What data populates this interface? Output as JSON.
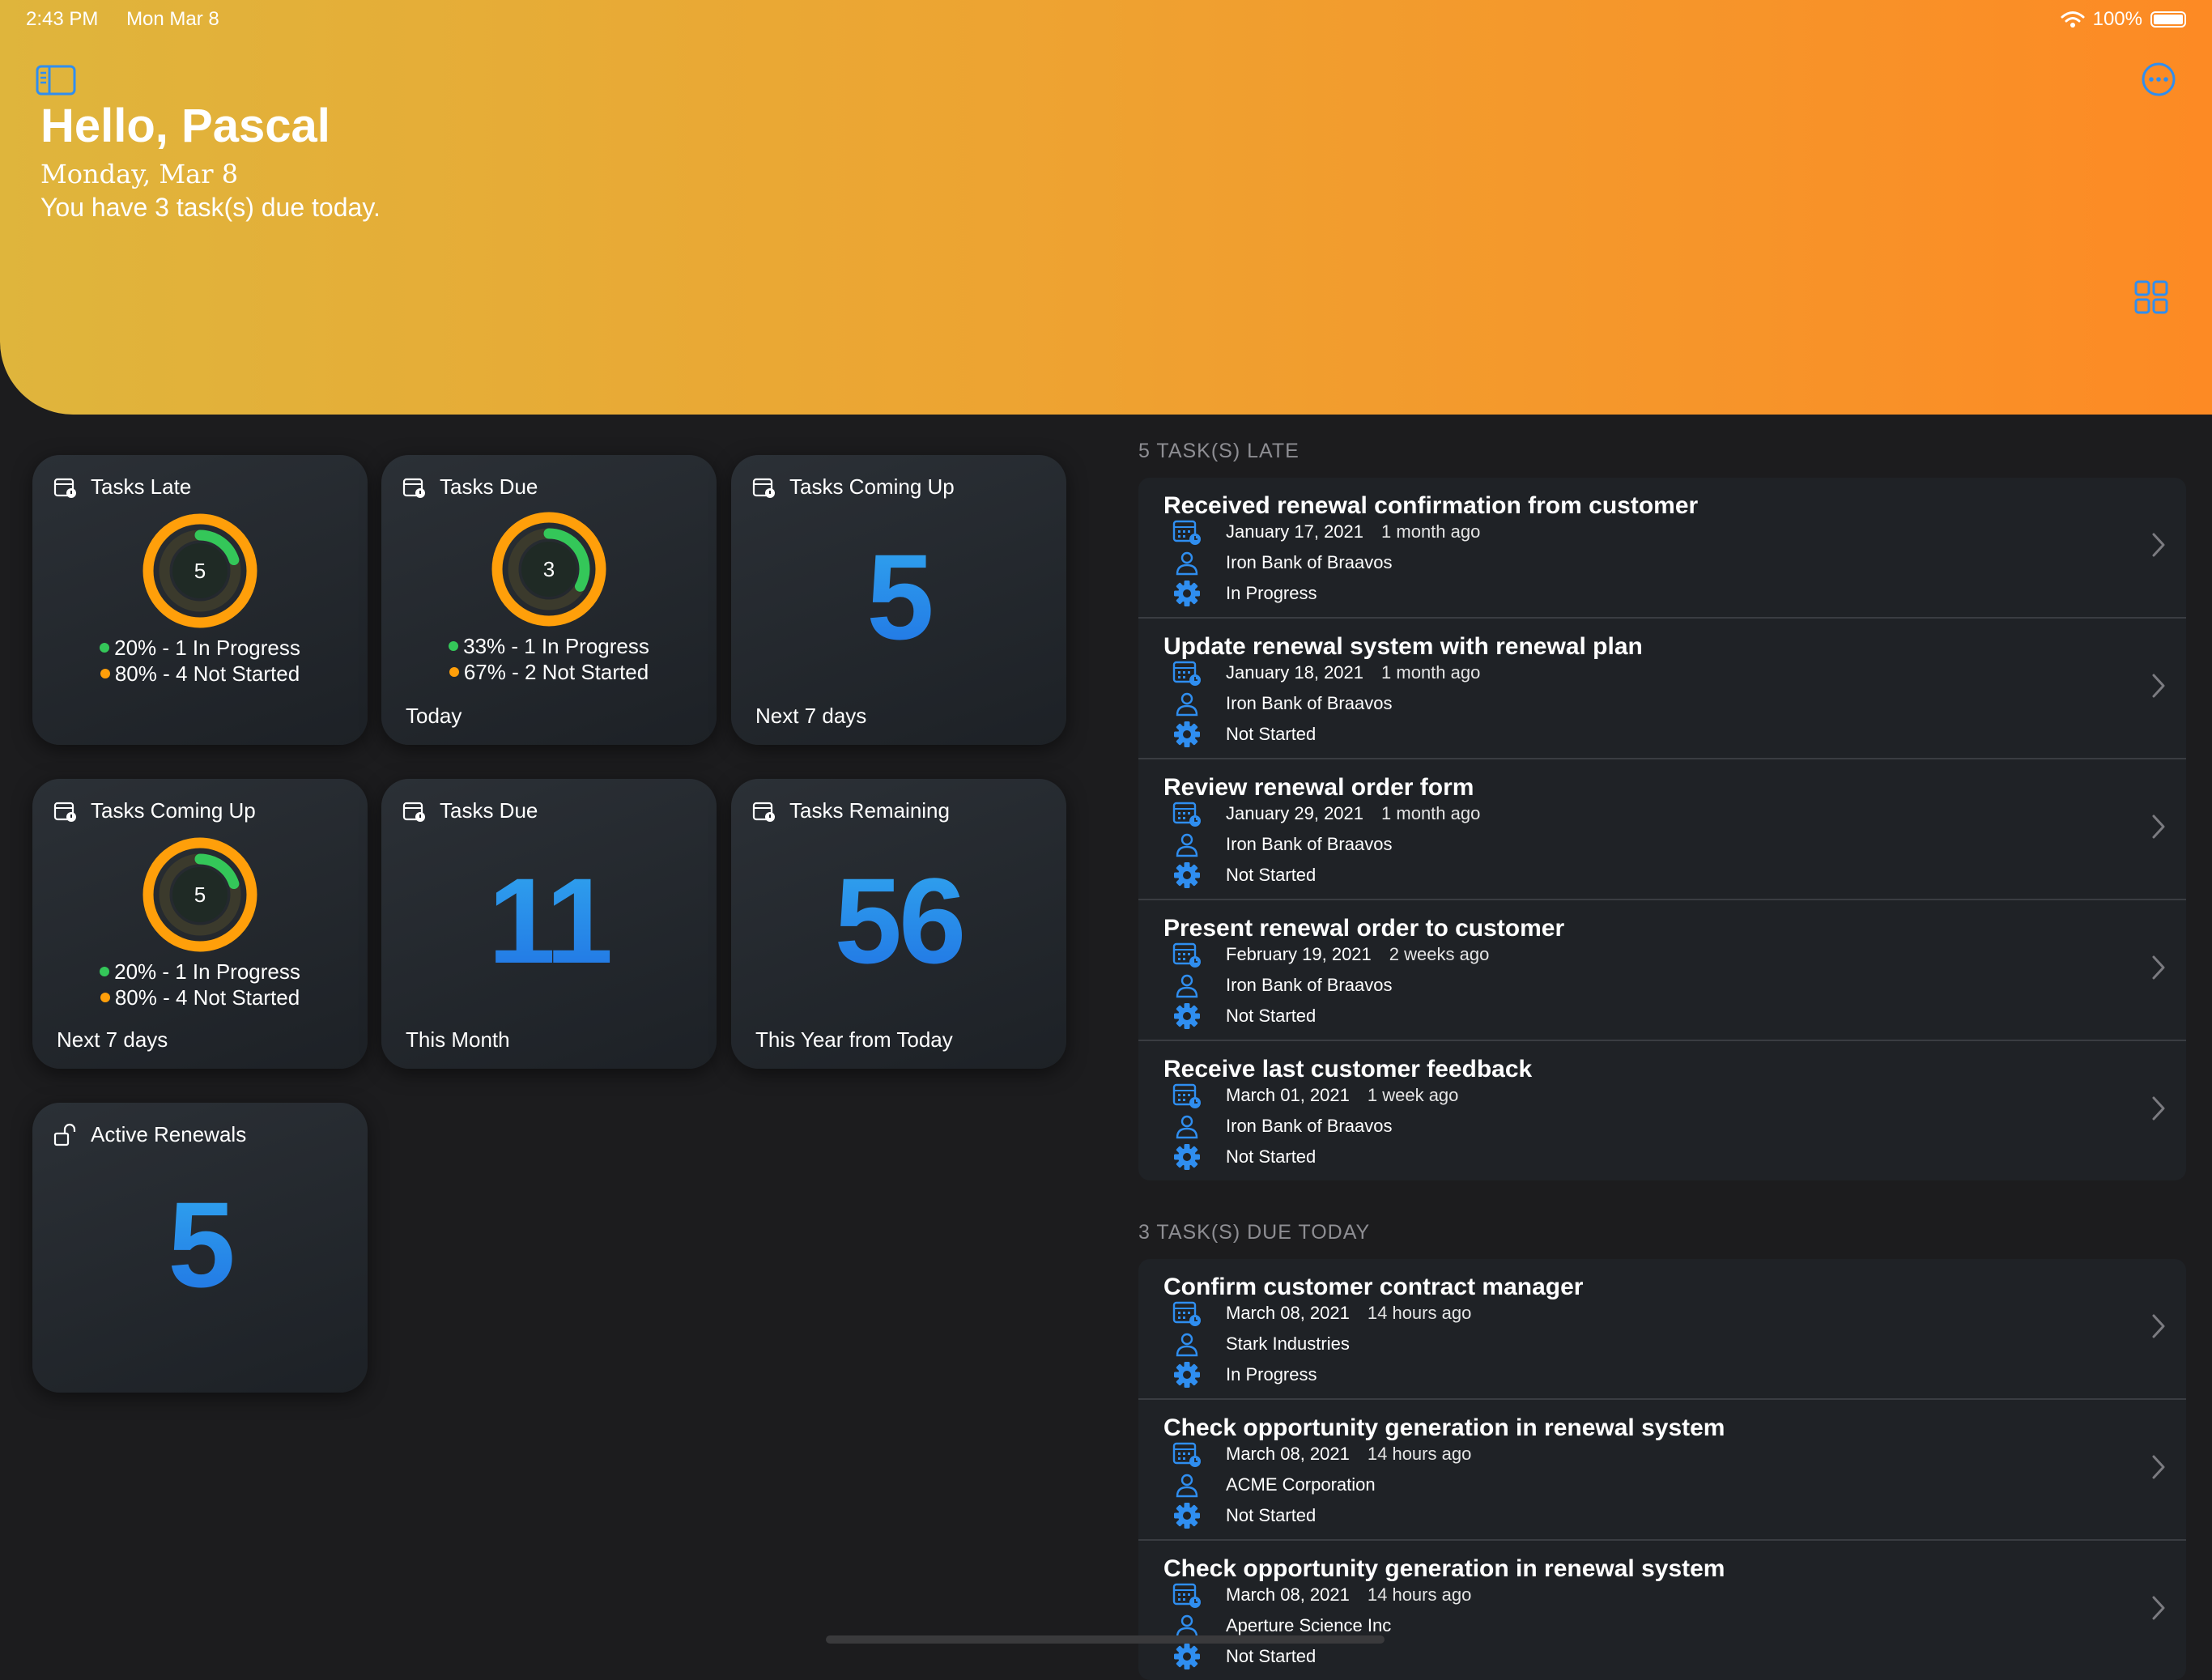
{
  "status_bar": {
    "time": "2:43 PM",
    "date": "Mon Mar 8",
    "battery": "100%"
  },
  "header": {
    "greeting": "Hello, Pascal",
    "date": "Monday, Mar 8",
    "due_message": "You have 3 task(s) due today."
  },
  "colors": {
    "accent": "#2f8ef0",
    "green": "#34c759",
    "orange": "#ff9f0a"
  },
  "cards": {
    "tasks_late": {
      "title": "Tasks Late",
      "count": "5",
      "in_progress": "20% - 1  In Progress",
      "not_started": "80% - 4  Not Started",
      "in_progress_fraction": 0.2
    },
    "tasks_due_today": {
      "title": "Tasks Due",
      "count": "3",
      "in_progress": "33% - 1  In Progress",
      "not_started": "67% - 2  Not Started",
      "footer": "Today",
      "in_progress_fraction": 0.33
    },
    "coming_up_big": {
      "title": "Tasks Coming Up",
      "value": "5",
      "footer": "Next 7 days"
    },
    "coming_up_donut": {
      "title": "Tasks Coming Up",
      "count": "5",
      "in_progress": "20% - 1  In Progress",
      "not_started": "80% - 4  Not Started",
      "footer": "Next 7 days",
      "in_progress_fraction": 0.2
    },
    "due_month": {
      "title": "Tasks Due",
      "value": "11",
      "footer": "This Month"
    },
    "remaining": {
      "title": "Tasks Remaining",
      "value": "56",
      "footer": "This Year from Today"
    },
    "active_renewals": {
      "title": "Active Renewals",
      "value": "5"
    }
  },
  "late_section": {
    "heading": "5 TASK(S) LATE",
    "tasks": [
      {
        "title": "Received renewal confirmation from customer",
        "date": "January 17, 2021",
        "ago": "1 month ago",
        "company": "Iron Bank of Braavos",
        "status": "In Progress"
      },
      {
        "title": "Update renewal system with renewal plan",
        "date": "January 18, 2021",
        "ago": "1 month ago",
        "company": "Iron Bank of Braavos",
        "status": "Not Started"
      },
      {
        "title": "Review renewal order form",
        "date": "January 29, 2021",
        "ago": "1 month ago",
        "company": "Iron Bank of Braavos",
        "status": "Not Started"
      },
      {
        "title": "Present renewal order to customer",
        "date": "February 19, 2021",
        "ago": "2 weeks ago",
        "company": "Iron Bank of Braavos",
        "status": "Not Started"
      },
      {
        "title": "Receive last customer feedback",
        "date": "March 01, 2021",
        "ago": "1 week ago",
        "company": "Iron Bank of Braavos",
        "status": "Not Started"
      }
    ]
  },
  "due_section": {
    "heading": "3 TASK(S) DUE TODAY",
    "tasks": [
      {
        "title": "Confirm customer contract manager",
        "date": "March 08, 2021",
        "ago": "14 hours ago",
        "company": "Stark Industries",
        "status": "In Progress"
      },
      {
        "title": "Check opportunity generation in renewal system",
        "date": "March 08, 2021",
        "ago": "14 hours ago",
        "company": "ACME Corporation",
        "status": "Not Started"
      },
      {
        "title": "Check opportunity generation in renewal system",
        "date": "March 08, 2021",
        "ago": "14 hours ago",
        "company": "Aperture Science Inc",
        "status": "Not Started"
      }
    ]
  }
}
